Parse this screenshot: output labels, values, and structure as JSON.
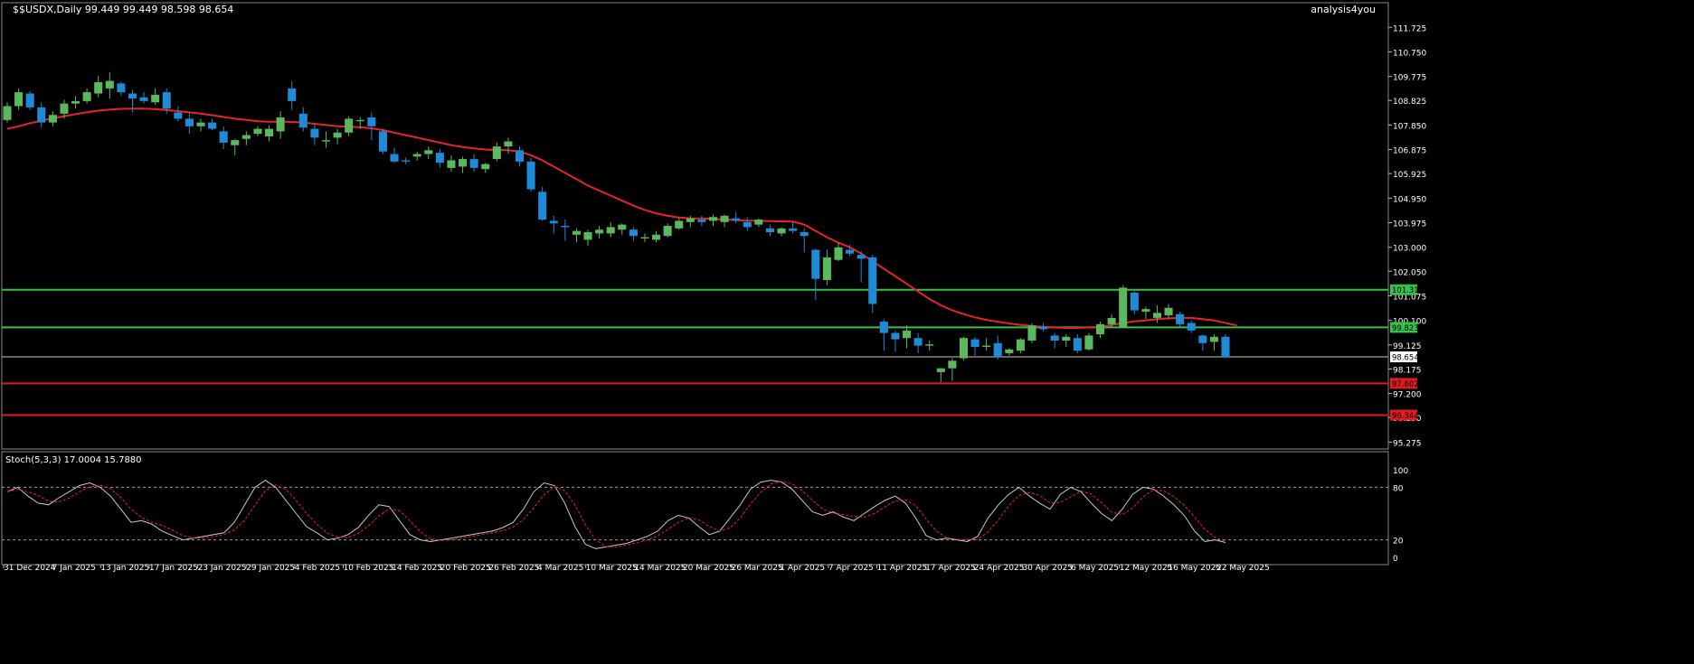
{
  "header": {
    "symbol_info": "$$USDX,Daily  99.449 99.449 98.598 98.654",
    "watermark": "analysis4you"
  },
  "colors": {
    "background": "#000000",
    "bull_candle": "#5cb85c",
    "bear_candle": "#1f8ad6",
    "moving_average": "#e8232a",
    "support_line": "#36c24a",
    "resistance_red": "#e01b1b",
    "current_price_line": "#c8c8c8",
    "stoch_main": "#c8c8c8",
    "stoch_signal": "#e8232a"
  },
  "price_axis": {
    "labels": [
      "111.725",
      "110.750",
      "109.775",
      "108.825",
      "107.850",
      "106.875",
      "105.925",
      "104.950",
      "103.975",
      "103.000",
      "102.050",
      "101.075",
      "100.100",
      "99.125",
      "98.175",
      "97.200",
      "96.250",
      "95.275"
    ],
    "level_badges": [
      {
        "label": "101.316",
        "value": 101.316,
        "color": "#36c24a",
        "kind": "horizontal-line"
      },
      {
        "label": "99.823",
        "value": 99.823,
        "color": "#36c24a",
        "kind": "horizontal-line"
      },
      {
        "label": "98.654",
        "value": 98.654,
        "color": "#ffffff",
        "kind": "current-price"
      },
      {
        "label": "97.602",
        "value": 97.602,
        "color": "#e01b1b",
        "kind": "horizontal-line"
      },
      {
        "label": "96.344",
        "value": 96.344,
        "color": "#e01b1b",
        "kind": "horizontal-line"
      }
    ]
  },
  "time_axis": {
    "labels": [
      "31 Dec 2024",
      "7 Jan 2025",
      "13 Jan 2025",
      "17 Jan 2025",
      "23 Jan 2025",
      "29 Jan 2025",
      "4 Feb 2025",
      "10 Feb 2025",
      "14 Feb 2025",
      "20 Feb 2025",
      "26 Feb 2025",
      "4 Mar 2025",
      "10 Mar 2025",
      "14 Mar 2025",
      "20 Mar 2025",
      "26 Mar 2025",
      "1 Apr 2025",
      "7 Apr 2025",
      "11 Apr 2025",
      "17 Apr 2025",
      "24 Apr 2025",
      "30 Apr 2025",
      "6 May 2025",
      "12 May 2025",
      "16 May 2025",
      "22 May 2025"
    ]
  },
  "stochastic": {
    "title": "Stoch(5,3,3) 17.0004 15.7880",
    "axis_labels": [
      "100",
      "80",
      "20",
      "0"
    ],
    "levels": [
      80,
      20
    ]
  },
  "chart_data": {
    "type": "candlestick",
    "symbol": "$$USDX",
    "timeframe": "Daily",
    "ylim": [
      95.0,
      112.2
    ],
    "candles": [
      [
        108.05,
        108.75,
        107.95,
        108.6
      ],
      [
        108.6,
        109.3,
        108.45,
        109.15
      ],
      [
        109.1,
        109.2,
        108.45,
        108.55
      ],
      [
        108.55,
        108.75,
        107.75,
        107.95
      ],
      [
        107.95,
        108.4,
        107.8,
        108.25
      ],
      [
        108.3,
        108.85,
        108.1,
        108.7
      ],
      [
        108.7,
        109.0,
        108.5,
        108.8
      ],
      [
        108.8,
        109.3,
        108.7,
        109.15
      ],
      [
        109.1,
        109.8,
        108.95,
        109.55
      ],
      [
        109.3,
        109.95,
        108.9,
        109.6
      ],
      [
        109.5,
        109.55,
        109.0,
        109.15
      ],
      [
        109.1,
        109.25,
        108.35,
        108.9
      ],
      [
        108.95,
        109.15,
        108.7,
        108.8
      ],
      [
        108.75,
        109.3,
        108.65,
        109.05
      ],
      [
        109.15,
        109.3,
        108.3,
        108.5
      ],
      [
        108.35,
        108.6,
        108.0,
        108.1
      ],
      [
        108.1,
        108.35,
        107.5,
        107.8
      ],
      [
        107.8,
        108.1,
        107.6,
        107.95
      ],
      [
        107.95,
        108.1,
        107.65,
        107.7
      ],
      [
        107.6,
        107.8,
        106.9,
        107.15
      ],
      [
        107.05,
        107.3,
        106.65,
        107.25
      ],
      [
        107.3,
        107.6,
        107.05,
        107.45
      ],
      [
        107.5,
        107.8,
        107.4,
        107.7
      ],
      [
        107.4,
        107.85,
        107.2,
        107.7
      ],
      [
        107.6,
        108.4,
        107.3,
        108.15
      ],
      [
        109.3,
        109.6,
        108.45,
        108.8
      ],
      [
        108.3,
        108.55,
        107.6,
        107.75
      ],
      [
        107.7,
        107.9,
        107.05,
        107.35
      ],
      [
        107.2,
        107.6,
        106.95,
        107.25
      ],
      [
        107.35,
        107.7,
        107.1,
        107.55
      ],
      [
        107.55,
        108.2,
        107.4,
        108.1
      ],
      [
        108.0,
        108.15,
        107.7,
        108.05
      ],
      [
        108.15,
        108.35,
        107.25,
        107.8
      ],
      [
        107.6,
        107.7,
        106.7,
        106.8
      ],
      [
        106.7,
        106.95,
        106.35,
        106.4
      ],
      [
        106.45,
        106.55,
        106.3,
        106.4
      ],
      [
        106.6,
        106.8,
        106.45,
        106.7
      ],
      [
        106.7,
        107.0,
        106.5,
        106.85
      ],
      [
        106.75,
        106.9,
        106.15,
        106.35
      ],
      [
        106.15,
        106.65,
        106.0,
        106.45
      ],
      [
        106.2,
        106.6,
        105.95,
        106.5
      ],
      [
        106.5,
        106.7,
        106.0,
        106.15
      ],
      [
        106.1,
        106.35,
        105.95,
        106.3
      ],
      [
        106.5,
        107.15,
        106.4,
        107.0
      ],
      [
        107.0,
        107.35,
        106.7,
        107.2
      ],
      [
        106.85,
        107.0,
        106.2,
        106.4
      ],
      [
        106.4,
        106.55,
        105.2,
        105.3
      ],
      [
        105.2,
        105.4,
        104.05,
        104.1
      ],
      [
        104.05,
        104.25,
        103.55,
        103.95
      ],
      [
        103.85,
        104.1,
        103.25,
        103.8
      ],
      [
        103.5,
        103.75,
        103.2,
        103.65
      ],
      [
        103.3,
        103.7,
        103.05,
        103.6
      ],
      [
        103.55,
        103.85,
        103.35,
        103.7
      ],
      [
        103.55,
        104.0,
        103.4,
        103.8
      ],
      [
        103.7,
        103.95,
        103.5,
        103.9
      ],
      [
        103.7,
        103.8,
        103.25,
        103.45
      ],
      [
        103.35,
        103.55,
        103.2,
        103.4
      ],
      [
        103.3,
        103.65,
        103.2,
        103.5
      ],
      [
        103.45,
        103.95,
        103.4,
        103.85
      ],
      [
        103.75,
        104.15,
        103.7,
        104.05
      ],
      [
        104.0,
        104.25,
        103.8,
        104.15
      ],
      [
        104.1,
        104.25,
        103.85,
        104.0
      ],
      [
        104.05,
        104.3,
        103.85,
        104.2
      ],
      [
        104.0,
        104.3,
        103.8,
        104.25
      ],
      [
        104.15,
        104.4,
        103.95,
        104.05
      ],
      [
        104.0,
        104.2,
        103.65,
        103.8
      ],
      [
        103.9,
        104.15,
        103.8,
        104.1
      ],
      [
        103.75,
        103.9,
        103.45,
        103.6
      ],
      [
        103.55,
        103.8,
        103.45,
        103.75
      ],
      [
        103.75,
        104.0,
        103.55,
        103.65
      ],
      [
        103.6,
        103.75,
        102.8,
        103.45
      ],
      [
        102.9,
        102.95,
        100.9,
        101.75
      ],
      [
        101.7,
        102.9,
        101.5,
        102.6
      ],
      [
        102.5,
        103.2,
        102.45,
        103.0
      ],
      [
        102.9,
        103.1,
        102.65,
        102.75
      ],
      [
        102.7,
        102.85,
        101.6,
        102.55
      ],
      [
        102.6,
        102.7,
        100.4,
        100.75
      ],
      [
        100.05,
        100.15,
        98.9,
        99.6
      ],
      [
        99.6,
        99.7,
        98.85,
        99.35
      ],
      [
        99.4,
        99.9,
        99.0,
        99.7
      ],
      [
        99.4,
        99.6,
        98.8,
        99.1
      ],
      [
        99.1,
        99.3,
        98.9,
        99.15
      ],
      [
        98.05,
        98.1,
        97.65,
        98.2
      ],
      [
        98.2,
        98.6,
        97.7,
        98.5
      ],
      [
        98.6,
        99.45,
        98.5,
        99.4
      ],
      [
        99.35,
        99.45,
        98.7,
        99.05
      ],
      [
        99.05,
        99.4,
        98.9,
        99.1
      ],
      [
        99.2,
        99.5,
        98.55,
        98.65
      ],
      [
        98.8,
        99.0,
        98.7,
        98.95
      ],
      [
        98.9,
        99.4,
        98.8,
        99.35
      ],
      [
        99.3,
        100.0,
        99.2,
        99.9
      ],
      [
        99.85,
        100.0,
        99.65,
        99.75
      ],
      [
        99.5,
        99.6,
        99.0,
        99.3
      ],
      [
        99.3,
        99.55,
        99.05,
        99.45
      ],
      [
        99.4,
        99.55,
        98.8,
        98.9
      ],
      [
        98.95,
        99.6,
        98.9,
        99.5
      ],
      [
        99.55,
        100.05,
        99.4,
        99.95
      ],
      [
        99.95,
        100.35,
        99.8,
        100.2
      ],
      [
        99.85,
        101.5,
        99.8,
        101.4
      ],
      [
        101.2,
        101.25,
        100.35,
        100.5
      ],
      [
        100.45,
        100.65,
        100.15,
        100.55
      ],
      [
        100.2,
        100.7,
        100.0,
        100.4
      ],
      [
        100.3,
        100.75,
        100.15,
        100.6
      ],
      [
        100.35,
        100.45,
        99.85,
        99.95
      ],
      [
        100.0,
        100.1,
        99.6,
        99.7
      ],
      [
        99.5,
        99.55,
        98.9,
        99.2
      ],
      [
        99.25,
        99.55,
        98.9,
        99.45
      ],
      [
        99.45,
        99.55,
        98.6,
        98.654
      ]
    ],
    "moving_average": [
      107.7,
      107.8,
      107.92,
      108.02,
      108.12,
      108.2,
      108.28,
      108.36,
      108.42,
      108.46,
      108.49,
      108.5,
      108.5,
      108.48,
      108.45,
      108.4,
      108.35,
      108.3,
      108.24,
      108.17,
      108.1,
      108.05,
      108.0,
      107.98,
      107.98,
      107.97,
      107.95,
      107.9,
      107.85,
      107.8,
      107.78,
      107.76,
      107.72,
      107.65,
      107.55,
      107.45,
      107.35,
      107.25,
      107.15,
      107.05,
      106.98,
      106.92,
      106.88,
      106.86,
      106.85,
      106.8,
      106.65,
      106.45,
      106.2,
      105.95,
      105.7,
      105.45,
      105.25,
      105.05,
      104.85,
      104.65,
      104.48,
      104.35,
      104.25,
      104.18,
      104.15,
      104.15,
      104.12,
      104.1,
      104.08,
      104.06,
      104.05,
      104.04,
      104.03,
      104.02,
      103.9,
      103.65,
      103.4,
      103.18,
      103.0,
      102.75,
      102.45,
      102.15,
      101.85,
      101.55,
      101.25,
      100.95,
      100.7,
      100.5,
      100.35,
      100.22,
      100.12,
      100.05,
      99.98,
      99.92,
      99.88,
      99.85,
      99.82,
      99.8,
      99.8,
      99.82,
      99.85,
      99.92,
      100.0,
      100.06,
      100.1,
      100.15,
      100.18,
      100.2,
      100.2,
      100.15,
      100.1,
      100.0,
      99.9
    ],
    "horizontal_levels": [
      101.316,
      99.823,
      97.602,
      96.344
    ],
    "current_price": 98.654,
    "stochastic": {
      "main": [
        75,
        80,
        70,
        62,
        60,
        68,
        75,
        82,
        85,
        80,
        70,
        55,
        40,
        42,
        38,
        30,
        25,
        20,
        22,
        24,
        26,
        28,
        40,
        60,
        80,
        88,
        80,
        65,
        50,
        35,
        28,
        20,
        22,
        26,
        34,
        48,
        60,
        58,
        42,
        26,
        20,
        18,
        20,
        22,
        24,
        26,
        28,
        30,
        34,
        40,
        55,
        75,
        85,
        82,
        62,
        35,
        15,
        10,
        12,
        14,
        16,
        20,
        24,
        30,
        42,
        48,
        45,
        35,
        26,
        30,
        45,
        60,
        78,
        86,
        88,
        86,
        78,
        65,
        52,
        48,
        52,
        46,
        42,
        50,
        58,
        65,
        70,
        62,
        45,
        25,
        20,
        22,
        20,
        18,
        24,
        45,
        60,
        72,
        80,
        70,
        62,
        55,
        72,
        80,
        75,
        62,
        50,
        42,
        55,
        72,
        80,
        78,
        70,
        60,
        48,
        30,
        18,
        20,
        17
      ]
    }
  }
}
